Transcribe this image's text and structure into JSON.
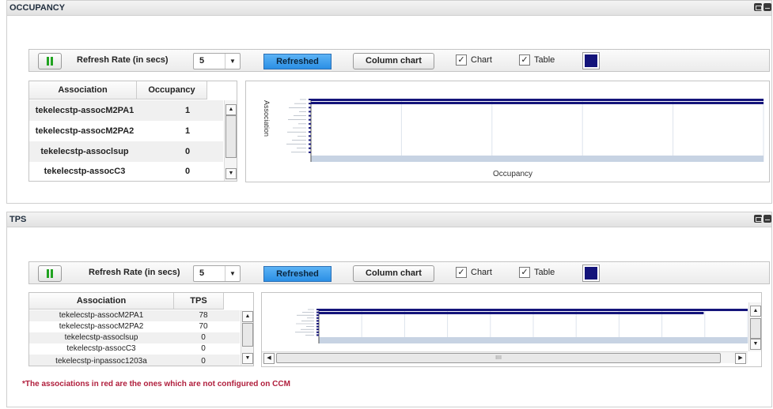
{
  "occupancy": {
    "title": "OCCUPANCY",
    "toolbar": {
      "rate_label": "Refresh Rate (in secs)",
      "rate_value": "5",
      "refreshed_label": "Refreshed",
      "column_chart_label": "Column chart",
      "chart_checkbox_label": "Chart",
      "chart_checked": true,
      "table_checkbox_label": "Table",
      "table_checked": true,
      "series_color": "#14147a"
    },
    "table": {
      "columns": [
        "Association",
        "Occupancy"
      ],
      "rows": [
        {
          "association": "tekelecstp-assocM2PA1",
          "value": "1"
        },
        {
          "association": "tekelecstp-assocM2PA2",
          "value": "1"
        },
        {
          "association": "tekelecstp-assoclsup",
          "value": "0"
        },
        {
          "association": "tekelecstp-assocC3",
          "value": "0"
        }
      ]
    },
    "chart_labels": {
      "y_axis": "Association",
      "x_axis": "Occupancy"
    }
  },
  "tps": {
    "title": "TPS",
    "toolbar": {
      "rate_label": "Refresh Rate (in secs)",
      "rate_value": "5",
      "refreshed_label": "Refreshed",
      "column_chart_label": "Column chart",
      "chart_checkbox_label": "Chart",
      "chart_checked": true,
      "table_checkbox_label": "Table",
      "table_checked": true,
      "series_color": "#14147a"
    },
    "table": {
      "columns": [
        "Association",
        "TPS"
      ],
      "rows": [
        {
          "association": "tekelecstp-assocM2PA1",
          "value": "78"
        },
        {
          "association": "tekelecstp-assocM2PA2",
          "value": "70"
        },
        {
          "association": "tekelecstp-assoclsup",
          "value": "0"
        },
        {
          "association": "tekelecstp-assocC3",
          "value": "0"
        },
        {
          "association": "tekelecstp-inpassoc1203a",
          "value": "0"
        }
      ]
    },
    "chart_scroll_glyph": "IIII"
  },
  "footnote": "*The associations in red are the ones which are not configured on CCM",
  "icons": {
    "pause": "pause-icon",
    "maximize": "maximize-icon",
    "minimize": "minimize-icon",
    "dropdown": "chevron-down-icon",
    "scroll_up": "arrow-up-icon",
    "scroll_down": "arrow-down-icon",
    "scroll_left": "arrow-left-icon",
    "scroll_right": "arrow-right-icon"
  },
  "colors": {
    "refreshed_button": "#2b8fe5",
    "bar": "#14147a",
    "grid_band": "#c7d3e3",
    "footnote": "#b01e3c"
  }
}
